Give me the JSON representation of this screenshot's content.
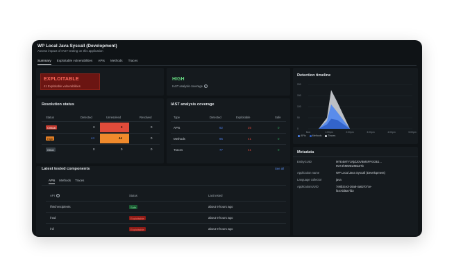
{
  "header": {
    "title": "WP Local Java Syscall (Development)",
    "subtitle": "Assess impact of IAST testing on this application"
  },
  "tabs": [
    {
      "label": "Summary"
    },
    {
      "label": "Exploitable vulnerabilities"
    },
    {
      "label": "APIs"
    },
    {
      "label": "Methods"
    },
    {
      "label": "Traces"
    }
  ],
  "exploitable": {
    "title": "EXPLOITABLE",
    "subtitle": "41 Exploitable vulnerabilities"
  },
  "coverage_summary": {
    "title": "HIGH",
    "subtitle": "IAST analysis coverage"
  },
  "resolution": {
    "title": "Resolution status",
    "headers": [
      "Status",
      "Detected",
      "Unresolved",
      "Resolved"
    ],
    "rows": [
      {
        "status": "Critical",
        "detected": "3",
        "unresolved": "3",
        "resolved": "0"
      },
      {
        "status": "High",
        "detected": "44",
        "unresolved": "44",
        "resolved": "0"
      },
      {
        "status": "Other",
        "detected": "0",
        "unresolved": "0",
        "resolved": "0"
      }
    ]
  },
  "iast": {
    "title": "IAST analysis coverage",
    "headers": [
      "Type",
      "Detected",
      "Exploitable",
      "Safe"
    ],
    "rows": [
      {
        "type": "APIs",
        "detected": "92",
        "exploitable": "35",
        "safe": "0"
      },
      {
        "type": "Methods",
        "detected": "95",
        "exploitable": "41",
        "safe": "0"
      },
      {
        "type": "Traces",
        "detected": "77",
        "exploitable": "41",
        "safe": "0"
      }
    ]
  },
  "timeline": {
    "title": "Detection timeline",
    "y_ticks": [
      "200",
      "150",
      "100",
      "50",
      "0"
    ],
    "x_ticks": [
      "Mon",
      "1:00pm",
      "2:00pm",
      "3:00pm",
      "4:00pm",
      "5:00pm"
    ],
    "legend": [
      {
        "label": "APIs",
        "color": "#4f86f0"
      },
      {
        "label": "Methods",
        "color": "#2f5fc8"
      },
      {
        "label": "Traces",
        "color": "#d9dde2"
      }
    ]
  },
  "chart_data": {
    "type": "area",
    "title": "Detection timeline",
    "categories": [
      "Mon",
      "1:00pm",
      "2:00pm",
      "3:00pm",
      "4:00pm",
      "5:00pm"
    ],
    "x": [
      0,
      0.5,
      0.9,
      1.1,
      1.4,
      2,
      3,
      4,
      5
    ],
    "series": [
      {
        "name": "Traces",
        "values": [
          0,
          0,
          50,
          175,
          120,
          0,
          0,
          0,
          0
        ],
        "color": "#d9dde2"
      },
      {
        "name": "APIs",
        "values": [
          0,
          0,
          35,
          110,
          75,
          0,
          0,
          0,
          0
        ],
        "color": "#4f86f0"
      },
      {
        "name": "Methods",
        "values": [
          0,
          0,
          20,
          45,
          40,
          0,
          0,
          0,
          0
        ],
        "color": "#2f5fc8"
      }
    ],
    "ylim": [
      0,
      200
    ]
  },
  "metadata": {
    "title": "Metadata",
    "rows": [
      {
        "key": "EntityGUID",
        "value": "MTE4MTY1NjdJOVBMSFFGOEJ...",
        "value2": "9OTJhMWEwMDZTb"
      },
      {
        "key": "Application name",
        "value": "WP Local Java Syscall (Development)"
      },
      {
        "key": "Language collector",
        "value": "java"
      },
      {
        "key": "ApplicationUUID",
        "value": "7e8b2ce3-16a8-4a62-b7ce-",
        "value2": "f347dd8a7fd3"
      }
    ]
  },
  "components": {
    "title": "Latest tested components",
    "view_all": "See all",
    "tabs": [
      "APIs",
      "Methods",
      "Traces"
    ],
    "headers": [
      "API",
      "Status",
      "Last tested"
    ],
    "rows": [
      {
        "api": "/fetchrecipients",
        "status": "Safe",
        "last": "about 9 hours ago"
      },
      {
        "api": "/nsd",
        "status": "Exploitable",
        "last": "about 9 hours ago"
      },
      {
        "api": "/nil",
        "status": "Exploitable",
        "last": "about 9 hours ago"
      }
    ]
  }
}
